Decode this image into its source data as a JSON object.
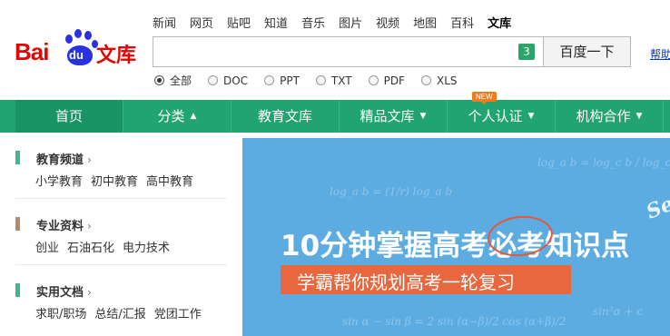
{
  "logo": {
    "bai": "Bai",
    "du": "du",
    "wenku": "文库"
  },
  "top_links": [
    {
      "label": "新闻",
      "active": false
    },
    {
      "label": "网页",
      "active": false
    },
    {
      "label": "贴吧",
      "active": false
    },
    {
      "label": "知道",
      "active": false
    },
    {
      "label": "音乐",
      "active": false
    },
    {
      "label": "图片",
      "active": false
    },
    {
      "label": "视频",
      "active": false
    },
    {
      "label": "地图",
      "active": false
    },
    {
      "label": "百科",
      "active": false
    },
    {
      "label": "文库",
      "active": true
    }
  ],
  "search": {
    "value": "",
    "placeholder": "",
    "badge": "3",
    "button_label": "百度一下",
    "help_label": "帮助"
  },
  "filters": [
    {
      "label": "全部",
      "checked": true
    },
    {
      "label": "DOC",
      "checked": false
    },
    {
      "label": "PPT",
      "checked": false
    },
    {
      "label": "TXT",
      "checked": false
    },
    {
      "label": "PDF",
      "checked": false
    },
    {
      "label": "XLS",
      "checked": false
    }
  ],
  "nav": {
    "items": [
      {
        "label": "首页",
        "caret": ""
      },
      {
        "label": "分类",
        "caret": "▲"
      },
      {
        "label": "教育文库",
        "caret": ""
      },
      {
        "label": "精品文库",
        "caret": "▼"
      },
      {
        "label": "个人认证",
        "caret": "▼",
        "tag": "NEW"
      },
      {
        "label": "机构合作",
        "caret": "▼"
      }
    ]
  },
  "sidebar": {
    "categories": [
      {
        "title": "教育频道",
        "arrow": "›",
        "color": "#3fb98a",
        "links": [
          "小学教育",
          "初中教育",
          "高中教育"
        ]
      },
      {
        "title": "专业资料",
        "arrow": "›",
        "color": "#b38b6d",
        "links": [
          "创业",
          "石油石化",
          "电力技术"
        ]
      },
      {
        "title": "实用文档",
        "arrow": "›",
        "color": "#3fb98a",
        "links": [
          "求职/职场",
          "总结/汇报",
          "党团工作"
        ]
      }
    ]
  },
  "banner": {
    "headline": "10分钟掌握高考必考知识点",
    "subtitle": "学霸帮你规划高考一轮复习",
    "formulas": [
      "log_a b = log_c b / log_c a",
      "log_a b = (1/r) log_a b",
      "sin α − sin β = 2 sin (α−β)/2 cos (α+β)/2",
      "sin²α + c"
    ],
    "script": "Se",
    "accent_color": "#e8673f",
    "bg_color": "#5cace2"
  },
  "colors": {
    "nav_green": "#22a471",
    "brand_red": "#e10602",
    "brand_blue": "#2932e1"
  }
}
